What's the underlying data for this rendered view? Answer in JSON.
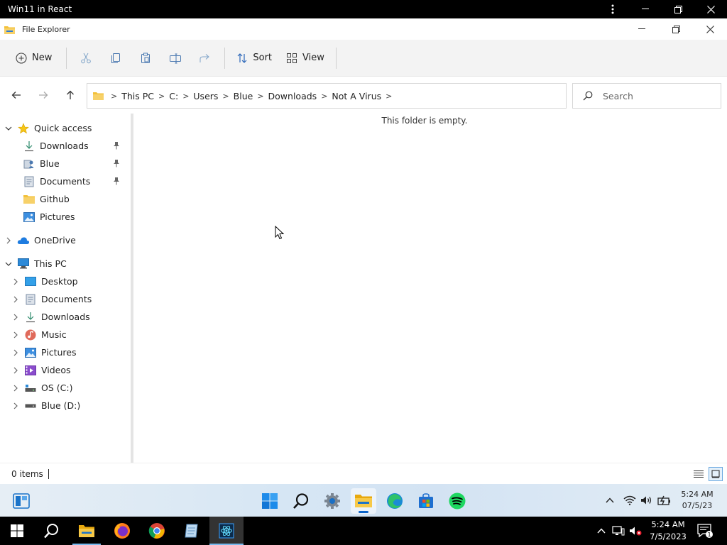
{
  "host": {
    "title": "Win11 in React"
  },
  "explorer": {
    "title": "File Explorer",
    "toolbar": {
      "new_label": "New",
      "sort_label": "Sort",
      "view_label": "View"
    },
    "address": {
      "crumbs": [
        "This PC",
        "C:",
        "Users",
        "Blue",
        "Downloads",
        "Not A Virus"
      ]
    },
    "search": {
      "placeholder": "Search"
    },
    "sidebar": {
      "quick_access": {
        "label": "Quick access",
        "items": [
          {
            "label": "Downloads",
            "icon": "download-icon",
            "pinned": true
          },
          {
            "label": "Blue",
            "icon": "user-folder-icon",
            "pinned": true
          },
          {
            "label": "Documents",
            "icon": "documents-icon",
            "pinned": true
          },
          {
            "label": "Github",
            "icon": "folder-icon",
            "pinned": false
          },
          {
            "label": "Pictures",
            "icon": "pictures-icon",
            "pinned": false
          }
        ]
      },
      "onedrive": {
        "label": "OneDrive"
      },
      "this_pc": {
        "label": "This PC",
        "items": [
          {
            "label": "Desktop",
            "icon": "desktop-icon"
          },
          {
            "label": "Documents",
            "icon": "documents-icon"
          },
          {
            "label": "Downloads",
            "icon": "download-icon"
          },
          {
            "label": "Music",
            "icon": "music-icon"
          },
          {
            "label": "Pictures",
            "icon": "pictures-icon"
          },
          {
            "label": "Videos",
            "icon": "videos-icon"
          },
          {
            "label": "OS (C:)",
            "icon": "drive-c-icon"
          },
          {
            "label": "Blue (D:)",
            "icon": "drive-d-icon"
          }
        ]
      }
    },
    "content": {
      "empty_message": "This folder is empty."
    },
    "status": {
      "items_count": "0 items"
    }
  },
  "inner_taskbar": {
    "clock_time": "5:24 AM",
    "clock_date": "07/5/23"
  },
  "host_taskbar": {
    "clock_time": "5:24 AM",
    "clock_date": "7/5/2023",
    "notification_count": "1"
  },
  "colors": {
    "accent": "#0a63c9",
    "folder": "#f3c13a",
    "host_bar": "#000000"
  }
}
